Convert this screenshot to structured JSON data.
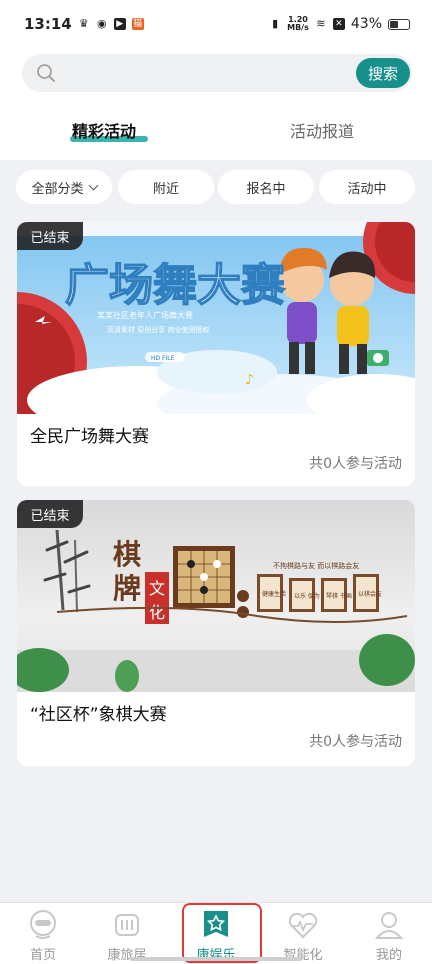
{
  "status_bar": {
    "time": "13:14",
    "net_speed_top": "1.20",
    "net_speed_bottom": "MB/s",
    "battery": "43%"
  },
  "search": {
    "placeholder": "",
    "button_label": "搜索"
  },
  "tabs": [
    {
      "label": "精彩活动",
      "active": true
    },
    {
      "label": "活动报道",
      "active": false
    }
  ],
  "filters": [
    {
      "label": "全部分类",
      "dropdown": true
    },
    {
      "label": "附近"
    },
    {
      "label": "报名中"
    },
    {
      "label": "活动中"
    }
  ],
  "activities": [
    {
      "status": "已结束",
      "title": "全民广场舞大赛",
      "participants": "共0人参与活动",
      "banner": {
        "headline": "广场舞大赛",
        "subline": "某某社区老年人广场舞大赛",
        "tags": "高清素材 原创分享 商业使用授权",
        "hd": "HD FILE"
      }
    },
    {
      "status": "已结束",
      "title": "“社区杯”象棋大赛",
      "participants": "共0人参与活动",
      "banner": {
        "char1": "棋",
        "char2": "牌",
        "seal1": "文",
        "seal2": "化",
        "slogan": "不拘棋路与友 而以棋路会友",
        "panels": [
          "健康生活",
          "以乐 促为",
          "琴棋 书画",
          "以棋会友"
        ]
      }
    }
  ],
  "bottom_nav": [
    {
      "label": "首页",
      "icon": "home-robot-icon"
    },
    {
      "label": "康旅居",
      "icon": "travel-bus-icon"
    },
    {
      "label": "康娱乐",
      "icon": "entertainment-star-icon",
      "active": true
    },
    {
      "label": "智能化",
      "icon": "heart-pulse-icon"
    },
    {
      "label": "我的",
      "icon": "user-icon"
    }
  ],
  "colors": {
    "accent": "#178f8b",
    "highlight": "#e23a3a"
  }
}
